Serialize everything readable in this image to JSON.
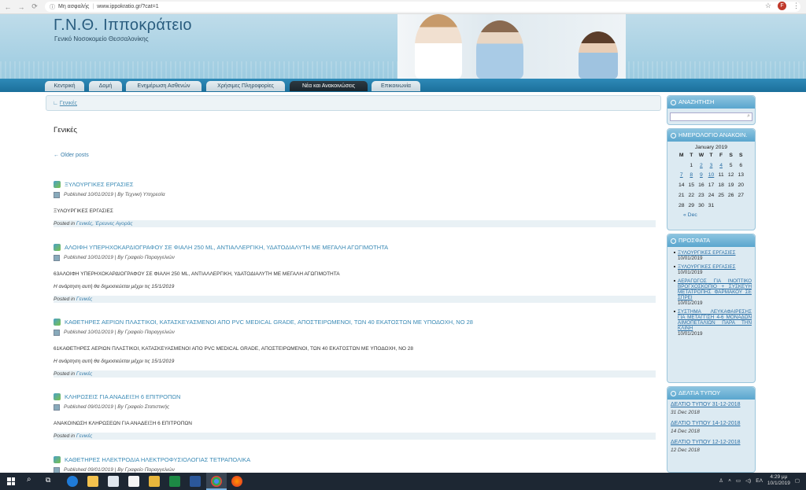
{
  "browser": {
    "security": "Μη ασφαλής",
    "url": "www.ippokratio.gr/?cat=1",
    "profile_initial": "F"
  },
  "header": {
    "title": "Γ.Ν.Θ. Ιπποκράτειο",
    "subtitle": "Γενικό Νοσοκομείο Θεσσαλονίκης"
  },
  "menu": {
    "items": [
      "Κεντρική",
      "Δομή",
      "Ενημέρωση Ασθενών",
      "Χρήσιμες Πληροφορίες",
      "Νέα και Ανακοινώσεις",
      "Επικοινωνία"
    ],
    "active_index": 4
  },
  "breadcrumb": "Γενικές",
  "page_title": "Γενικές",
  "older_posts": "← Older posts",
  "posts": [
    {
      "title": "ΞΥΛΟΥΡΓΙΚΕΣ ΕΡΓΑΣΙΕΣ",
      "published": "Published 10/01/2019",
      "by": "By Τεχνική Υπηρεσία",
      "excerpt": "ΞΥΛΟΥΡΓΙΚΕΣ ΕΡΓΑΣΙΕΣ",
      "note": "",
      "posted_in": "Posted in",
      "categories": "Γενικές, Έρευνες Αγοράς"
    },
    {
      "title": "ΑΛΟΙΦΗ ΥΠΕΡΗΧΟΚΑΡΔΙΟΓΡΑΦΟΥ ΣΕ ΦΙΑΛΗ 250 ML, ΑΝΤΙΑΛΛΕΡΓΙΚΗ, ΥΔΑΤΟΔΙΑΛΥΤΗ ΜΕ ΜΕΓΑΛΗ ΑΓΩΓΙΜΟΤΗΤΑ",
      "published": "Published 10/01/2019",
      "by": "By Γραφείο Παραγγελιών",
      "excerpt": "63ΑΛΟΙΦΗ ΥΠΕΡΗΧΟΚΑΡΔΙΟΓΡΑΦΟΥ ΣΕ ΦΙΑΛΗ 250 ML, ΑΝΤΙΑΛΛΕΡΓΙΚΗ, ΥΔΑΤΟΔΙΑΛΥΤΗ ΜΕ ΜΕΓΑΛΗ ΑΓΩΓΙΜΟΤΗΤΑ",
      "note": "Η ανάρτηση αυτή θα δημοσιεύεται μέχρι τις 15/1/2019",
      "posted_in": "Posted in",
      "categories": "Γενικές"
    },
    {
      "title": "ΚΑΘΕΤΗΡΕΣ ΑΕΡΙΩΝ ΠΛΑΣΤΙΚΟΙ, ΚΑΤΑΣΚΕΥΑΣΜΕΝΟΙ ΑΠΟ PVC MEDICAL GRADE, ΑΠΟΣΤΕΙΡΩΜΕΝΟΙ, ΤΩΝ 40 ΕΚΑΤΟΣΤΩΝ ΜΕ ΥΠΟΔΟΧΗ, ΝΟ 28",
      "published": "Published 10/01/2019",
      "by": "By Γραφείο Παραγγελιών",
      "excerpt": "61ΚΑΘΕΤΗΡΕΣ ΑΕΡΙΩΝ ΠΛΑΣΤΙΚΟΙ, ΚΑΤΑΣΚΕΥΑΣΜΕΝΟΙ ΑΠΟ PVC MEDICAL GRADE, ΑΠΟΣΤΕΙΡΩΜΕΝΟΙ, ΤΩΝ 40 ΕΚΑΤΟΣΤΩΝ ΜΕ ΥΠΟΔΟΧΗ, ΝΟ  28",
      "note": "Η ανάρτηση αυτή θα δημοσιεύεται μέχρι τις 15/1/2019",
      "posted_in": "Posted in",
      "categories": "Γενικές"
    },
    {
      "title": "ΚΛΗΡΩΣΕΙΣ ΓΙΑ ΑΝΑΔΕΙΞΗ 6 ΕΠΙΤΡΟΠΩΝ",
      "published": "Published 09/01/2019",
      "by": "By Γραφείο Στατιστικής",
      "excerpt": "ΑΝΑΚΟΙΝΩΣΗ ΚΛΗΡΩΣΕΩΝ ΓΙΑ ΑΝΑΔΕΙΞΗ 6 ΕΠΙΤΡΟΠΩΝ",
      "note": "",
      "posted_in": "Posted in",
      "categories": "Γενικές"
    },
    {
      "title": "ΚΑΘΕΤΗΡΕΣ ΗΛΕΚΤΡΟΔΙΑ ΗΛΕΚΤΡΟΦΥΣΙΟΛΟΓΙΑΣ ΤΕΤΡΑΠΟΛΙΚΑ",
      "published": "Published 09/01/2019",
      "by": "By Γραφείο Παραγγελιών",
      "excerpt": "",
      "note": "",
      "posted_in": "",
      "categories": ""
    }
  ],
  "sidebar": {
    "search_title": "ΑΝΑΖΗΤΗΣΗ",
    "calendar_title": "ΗΜΕΡΟΛΟΓΙΟ ΑΝΑΚΟΙΝ.",
    "calendar": {
      "caption": "January 2019",
      "headers": [
        "M",
        "T",
        "W",
        "T",
        "F",
        "S",
        "S"
      ],
      "rows": [
        [
          "",
          "1",
          "2",
          "3",
          "4",
          "5",
          "6"
        ],
        [
          "7",
          "8",
          "9",
          "10",
          "11",
          "12",
          "13"
        ],
        [
          "14",
          "15",
          "16",
          "17",
          "18",
          "19",
          "20"
        ],
        [
          "21",
          "22",
          "23",
          "24",
          "25",
          "26",
          "27"
        ],
        [
          "28",
          "29",
          "30",
          "31",
          "",
          "",
          ""
        ]
      ],
      "links": [
        "2",
        "3",
        "4",
        "7",
        "8",
        "9",
        "10"
      ],
      "prev": "« Dec"
    },
    "recent_title": "ΠΡΟΣΦΑΤΑ",
    "recent": [
      {
        "title": "ΞΥΛΟΥΡΓΙΚΕΣ ΕΡΓΑΣΙΕΣ",
        "date": "10/01/2019"
      },
      {
        "title": "ΞΥΛΟΥΡΓΙΚΕΣ ΕΡΓΑΣΙΕΣ",
        "date": "10/01/2019"
      },
      {
        "title": "ΑΕΡΑΓΩΓΟΣ ΓΙΑ ΙΝΟΠΤΙΚΟ ΒΡΟΓΧΟΣΚΟΠΙΟ + ΣΥΣΚΕΥΗ ΜΕΤΑΤΡΟΠΗΣ ΦΑΡΜΑΚΟΥ ΣΕ ΣΠΡΕΙ",
        "date": "10/01/2019"
      },
      {
        "title": "ΣΥΣΤΗΜΑ ΛΕΥΚΑΦΑΙΡΕΣΗΣ ΓΙΑ ΜΕΤΑΓΓΙΣΗ 4-6 ΜΟΝΑΔΩΝ ΑΙΜΟΠΕΤΑΛΙΩΝ ΠΑΡΑ ΤΗΝ ΚΛΙΝΗ",
        "date": "10/01/2019"
      }
    ],
    "press_title": "ΔΕΛΤΙΑ ΤΥΠΟΥ",
    "press": [
      {
        "title": "ΔΕΛΤΙΟ ΤΥΠΟΥ 31-12-2018",
        "date": "31 Dec 2018"
      },
      {
        "title": "ΔΕΛΤΙΟ ΤΥΠΟΥ 14-12-2018",
        "date": "14 Dec 2018"
      },
      {
        "title": "ΔΕΛΤΙΟ ΤΥΠΟΥ 12-12-2018",
        "date": "12 Dec 2018"
      }
    ]
  },
  "taskbar": {
    "time": "4:29 μμ",
    "date": "10/1/2019",
    "lang": "ΕΛ"
  }
}
